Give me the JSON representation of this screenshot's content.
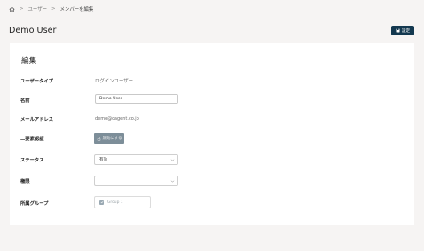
{
  "breadcrumb": {
    "home_icon": "home-icon",
    "separator": ">",
    "parent": "ユーザー",
    "current": "メンバーを編集"
  },
  "page_title": "Demo User",
  "save_button": {
    "label": "設定",
    "icon": "save-icon"
  },
  "form": {
    "section_title": "編集",
    "user_type": {
      "label": "ユーザータイプ",
      "value": "ログインユーザー"
    },
    "name": {
      "label": "名前",
      "value": "Demo User"
    },
    "email": {
      "label": "メールアドレス",
      "value": "demo@cagent.co.jp"
    },
    "two_factor": {
      "label": "二要素認証",
      "button_label": "無効にする",
      "icon": "lock-icon"
    },
    "status": {
      "label": "ステータス",
      "selected": "有効"
    },
    "permission": {
      "label": "権限",
      "selected": ""
    },
    "group": {
      "label": "所属グループ",
      "option": "Group 1",
      "checked": true
    }
  }
}
